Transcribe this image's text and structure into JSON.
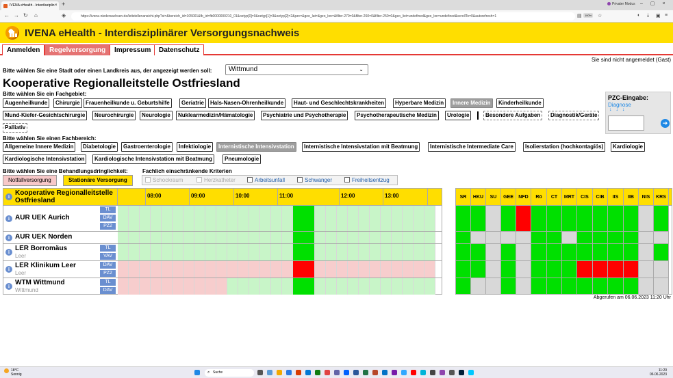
{
  "browser": {
    "tab_title": "IVENA eHealth - Interdisziplin",
    "tab_close": "×",
    "new_tab": "+",
    "private_mode": "Privater Modus",
    "url_domain": "ivena-niedersachsen.de",
    "url_path": "https://ivena-niedersachsen.de/leitstellenansicht.php?si=&bereich_id=105001&fb_id=fb0000000210_01&oetyp[0]=0&oetyp[1]=3&oetyp[2]=2&pzc=&geo_lat=&geo_lon=&filter-270=0&filter-260=0&filter-250=0&geo_list=undefined&geo_lon=undefined&scrollTo=0&autorefresh=1",
    "zoom": "100%"
  },
  "header": {
    "title": "IVENA eHealth - Interdisziplinärer Versorgungsnachweis"
  },
  "menu": [
    {
      "label": "Anmelden",
      "active": false
    },
    {
      "label": "Regelversorgung",
      "active": true
    },
    {
      "label": "Impressum",
      "active": false
    },
    {
      "label": "Datenschutz",
      "active": false
    }
  ],
  "login_status": "Sie sind nicht angemeldet (Gast)",
  "city": {
    "label": "Bitte wählen Sie eine Stadt oder einen Landkreis aus, der angezeigt werden soll:",
    "value": "Wittmund"
  },
  "page_title": "Kooperative Regionalleitstelle Ostfriesland",
  "fachgebiet": {
    "label": "Bitte wählen Sie ein Fachgebiet:",
    "items": [
      "Augenheilkunde",
      "Chirurgie",
      "Frauenheilkunde u. Geburtshilfe",
      "Geriatrie",
      "Hals-Nasen-Ohrenheilkunde",
      "Haut- und Geschlechtskrankheiten",
      "Hyperbare Medizin",
      "Innere Medizin",
      "Kinderheilkunde",
      "Mund-Kiefer-Gesichtschirurgie",
      "Neurochirurgie",
      "Neurologie",
      "Nuklearmedizin/Hämatologie",
      "Psychiatrie und Psychotherapie",
      "Psychotherapeutische Medizin",
      "Urologie",
      "Besondere Aufgaben",
      "Diagnostik/Geräte",
      "Palliativ"
    ],
    "selected": "Innere Medizin"
  },
  "fachbereich": {
    "label": "Bitte wählen Sie einen Fachbereich:",
    "items": [
      "Allgemeine Innere Medizin",
      "Diabetologie",
      "Gastroenterologie",
      "Infektiologie",
      "Internistische Intensivstation",
      "Internistische Intensivstation mit Beatmung",
      "Internistische Intermediate Care",
      "Isolierstation (hochkontagiös)",
      "Kardiologie",
      "Kardiologische Intensivstation",
      "Kardiologische Intensivstation mit Beatmung",
      "Pneumologie"
    ],
    "selected": "Internistische Intensivstation"
  },
  "pzc": {
    "title": "PZC-Eingabe:",
    "link": "Diagnose",
    "arrows": "↓ ↓ ↓",
    "go": "➔"
  },
  "urgency": {
    "label": "Bitte wählen Sie eine Behandlungsdringlichkeit:",
    "options": [
      "Notfallversorgung",
      "Stationäre Versorgung"
    ],
    "selected": "Stationäre Versorgung"
  },
  "criteria": {
    "label": "Fachlich einschränkende Kriterien",
    "items": [
      {
        "label": "Schockraum",
        "enabled": false
      },
      {
        "label": "Herzkatheter",
        "enabled": false
      },
      {
        "label": "Arbeitsunfall",
        "enabled": true
      },
      {
        "label": "Schwanger",
        "enabled": true
      },
      {
        "label": "Freiheitsentzug",
        "enabled": true
      }
    ]
  },
  "table": {
    "header_name": "Kooperative Regionalleitstelle Ostfriesland",
    "info_glyph": "i",
    "times": [
      "08:00",
      "09:00",
      "10:00",
      "11:00",
      "12:00",
      "13:00"
    ],
    "rows": [
      {
        "name": "AUR UEK Aurich",
        "sub": "",
        "tags": [
          "TL",
          "DAV",
          "PZ2"
        ]
      },
      {
        "name": "AUR UEK Norden",
        "sub": "",
        "tags": []
      },
      {
        "name": "LER Borromäus",
        "sub": "Leer",
        "tags": [
          "TL",
          "VAV"
        ]
      },
      {
        "name": "LER Klinikum Leer",
        "sub": "Leer",
        "tags": [
          "DAV",
          "PZ2"
        ]
      },
      {
        "name": "WTM Wittmund",
        "sub": "Wittmund",
        "tags": [
          "TL",
          "DAV"
        ]
      }
    ]
  },
  "resources": {
    "columns": [
      "SR",
      "HKU",
      "SU",
      "GEE",
      "NFD",
      "Rö",
      "CT",
      "MRT",
      "CIS",
      "CIB",
      "IIS",
      "IIB",
      "NIS",
      "KRS"
    ],
    "colors": {
      "green": "#00e000",
      "red": "#ff0000",
      "grey": "#d8d8d8"
    },
    "rows": [
      [
        "green",
        "green",
        "grey",
        "green",
        "red",
        "green",
        "green",
        "green",
        "green",
        "green",
        "green",
        "green",
        "grey",
        "green"
      ],
      [
        "green",
        "grey",
        "grey",
        "grey",
        "grey",
        "green",
        "green",
        "grey",
        "green",
        "green",
        "green",
        "green",
        "grey",
        "grey"
      ],
      [
        "green",
        "green",
        "grey",
        "green",
        "grey",
        "green",
        "green",
        "green",
        "green",
        "green",
        "green",
        "green",
        "grey",
        "green"
      ],
      [
        "green",
        "green",
        "grey",
        "green",
        "grey",
        "green",
        "green",
        "green",
        "red",
        "red",
        "red",
        "red",
        "grey",
        "grey"
      ],
      [
        "green",
        "grey",
        "grey",
        "green",
        "grey",
        "green",
        "green",
        "green",
        "green",
        "green",
        "green",
        "green",
        "grey",
        "grey"
      ]
    ]
  },
  "timestamp": "Abgerufen am 06.06.2023 11:20 Uhr",
  "taskbar": {
    "weather_temp": "18°C",
    "weather_desc": "Sonnig",
    "search": "Suche",
    "time": "11:20",
    "date": "06.06.2023"
  }
}
